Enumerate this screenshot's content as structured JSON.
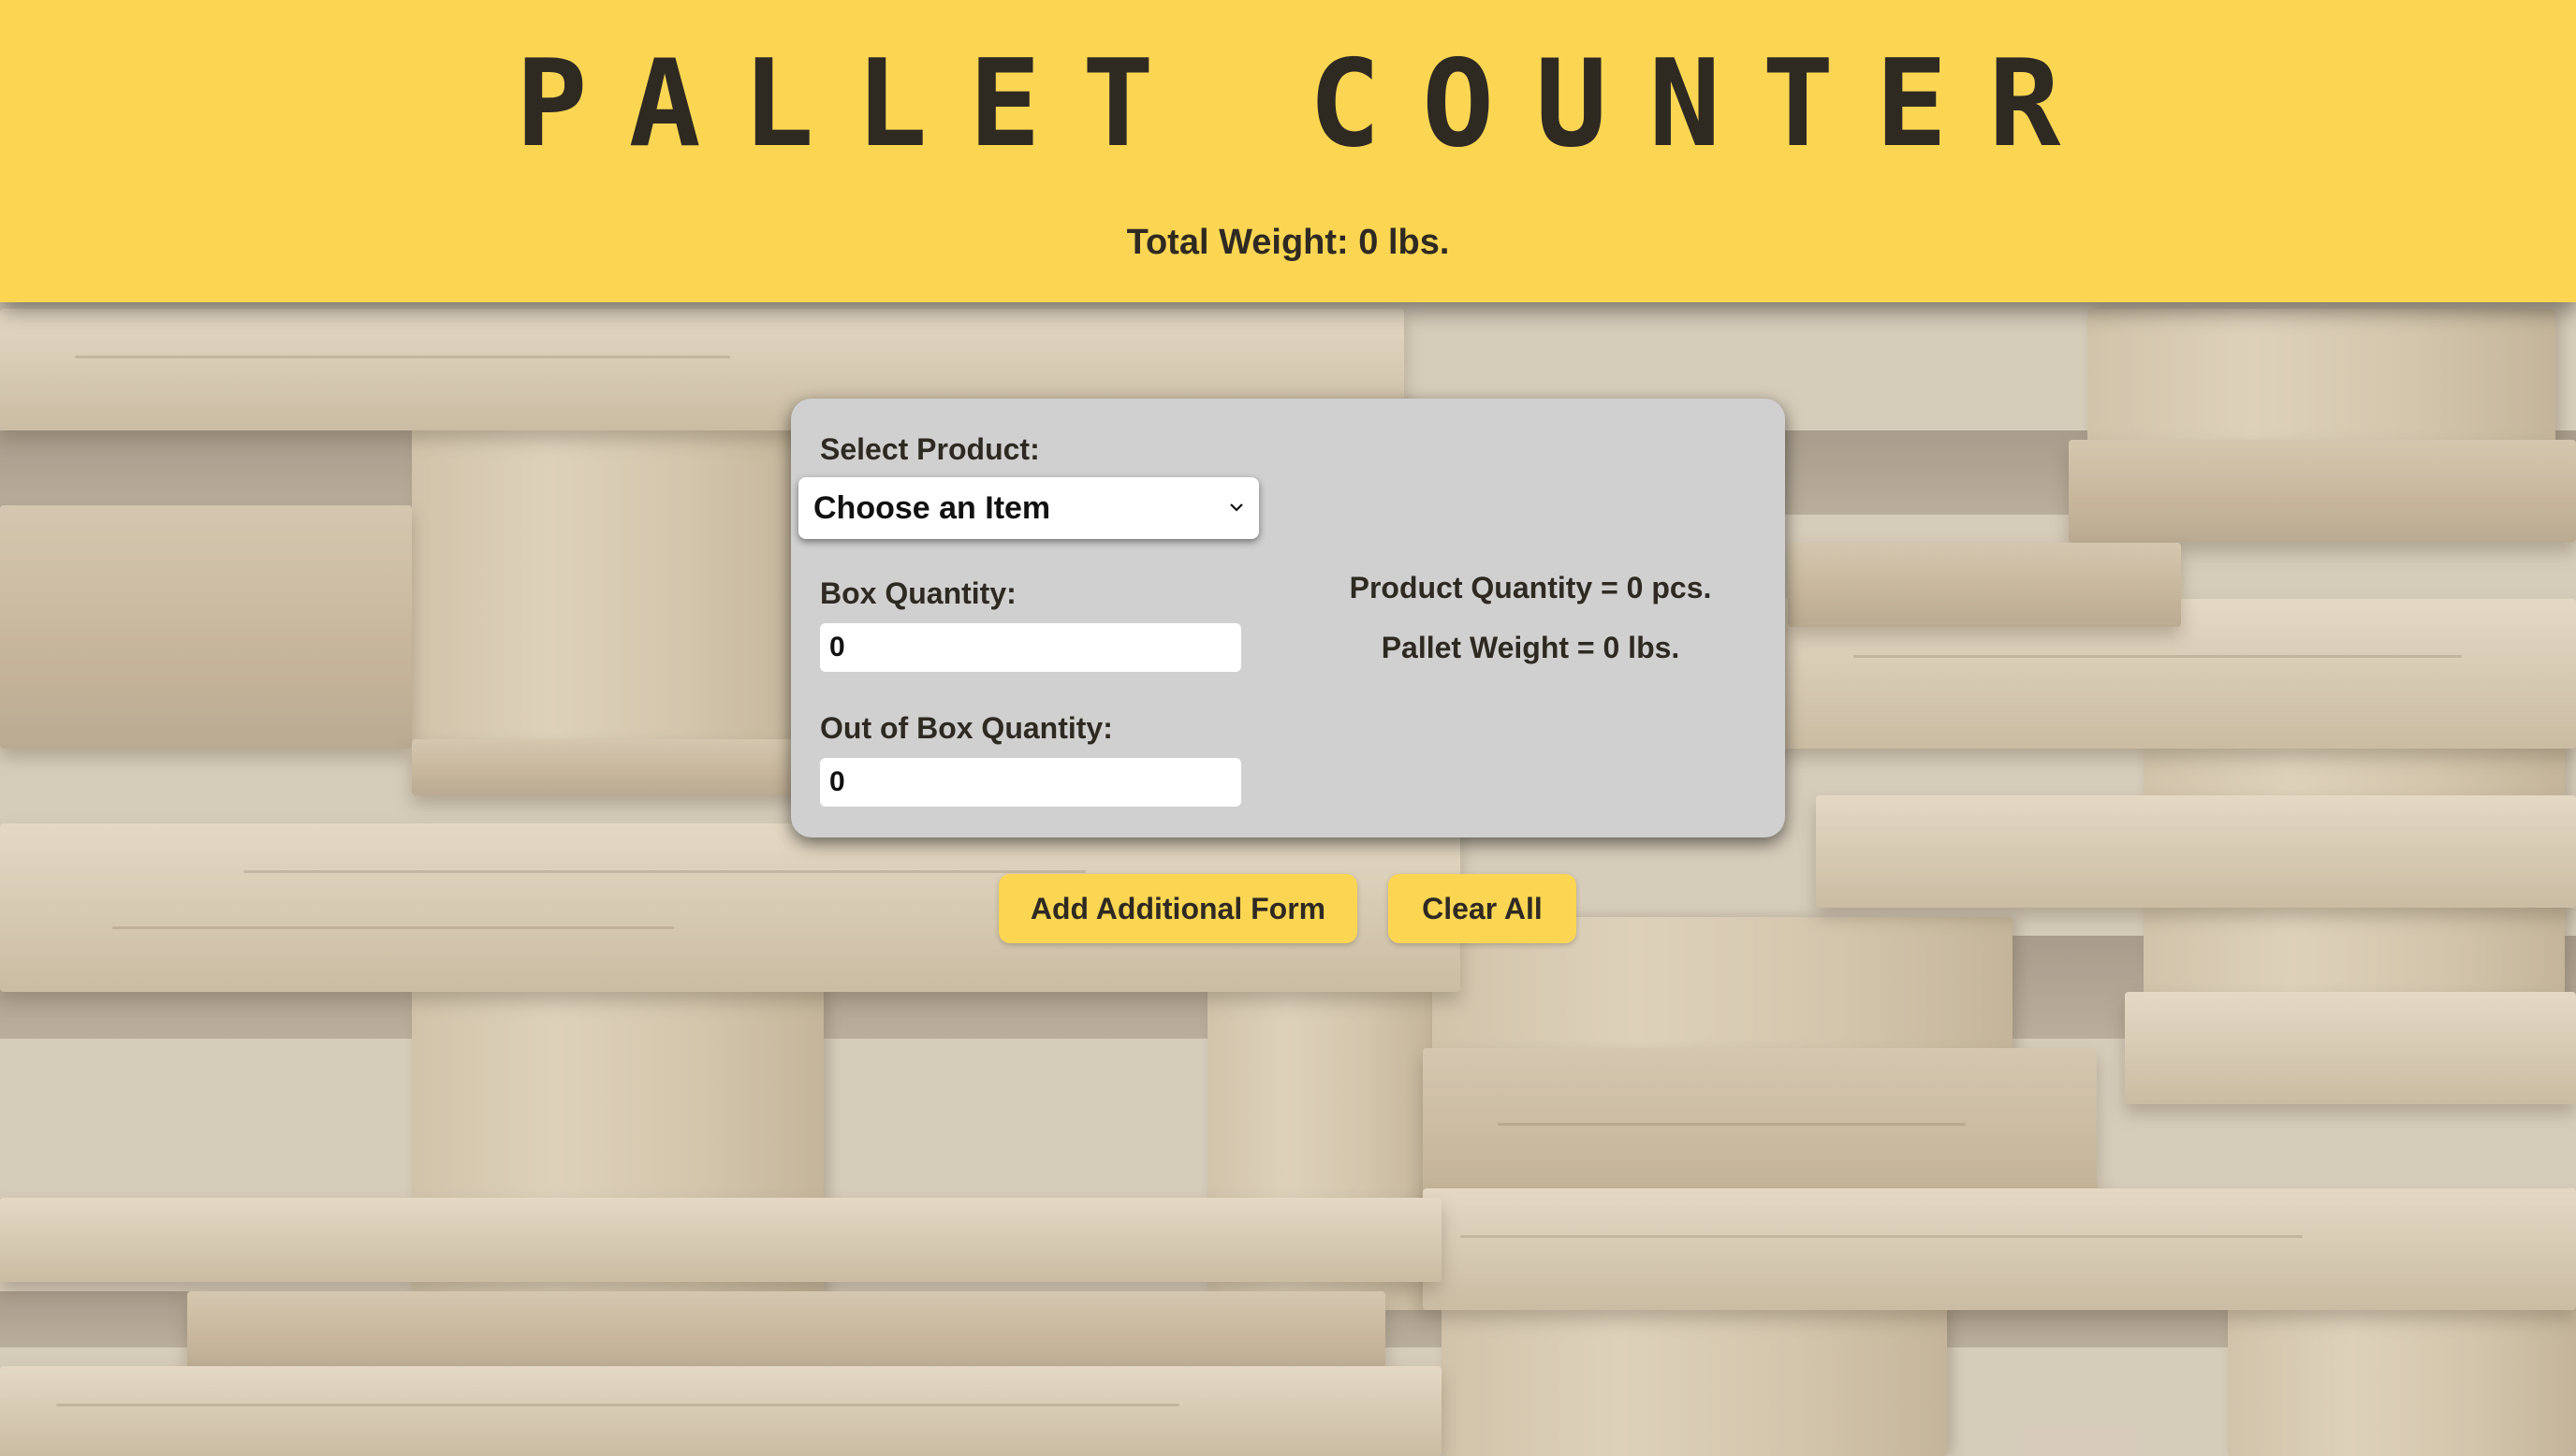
{
  "header": {
    "title": "PALLET COUNTER",
    "total_weight": "Total Weight: 0 lbs."
  },
  "form": {
    "product_label": "Select Product:",
    "product_select_value": "Choose an Item",
    "box_quantity_label": "Box Quantity:",
    "box_quantity_value": "0",
    "out_of_box_quantity_label": "Out of Box Quantity:",
    "out_of_box_quantity_value": "0",
    "product_quantity": "Product Quantity = 0 pcs.",
    "pallet_weight": "Pallet Weight = 0 lbs."
  },
  "actions": {
    "add_form_label": "Add Additional Form",
    "clear_all_label": "Clear All"
  },
  "colors": {
    "accent": "#fcd653",
    "card": "#d0d0d0",
    "text": "#2e2a22"
  },
  "icons": {
    "select_chevron": "chevron-down-icon"
  }
}
